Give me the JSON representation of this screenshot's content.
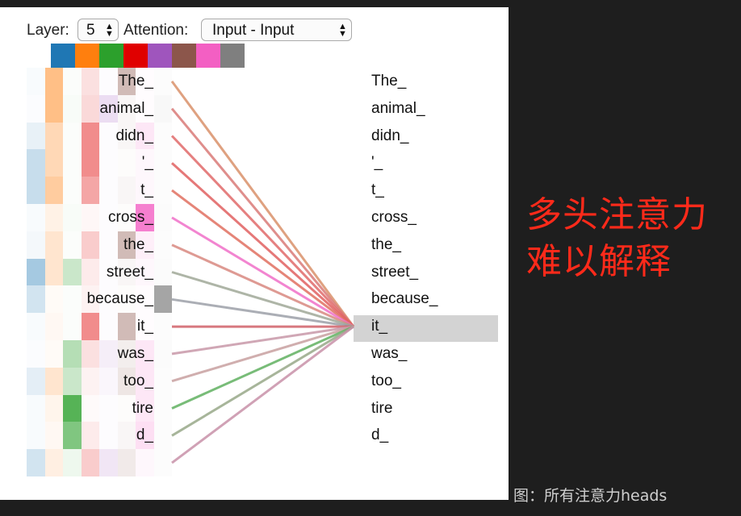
{
  "controls": {
    "layer_label": "Layer:",
    "layer_value": "5",
    "attention_label": "Attention:",
    "attention_value": "Input - Input"
  },
  "head_colors": [
    "#1f77b4",
    "#ff7f0e",
    "#2ca02c",
    "#e00000",
    "#9f55bd",
    "#8c564b",
    "#f35fc3",
    "#7f7f7f"
  ],
  "tokens": [
    "The_",
    "animal_",
    "didn_",
    "'_",
    "t_",
    "cross_",
    "the_",
    "street_",
    "because_",
    "it_",
    "was_",
    "too_",
    "tire",
    "d_",
    ""
  ],
  "selected_token": "it_",
  "attention": [
    [
      0.03,
      0.5,
      0,
      0.12,
      0,
      0.4,
      0.02,
      0
    ],
    [
      0.02,
      0.5,
      0.03,
      0.15,
      0.2,
      0.05,
      0.02,
      0.05
    ],
    [
      0.1,
      0.3,
      0.02,
      0.45,
      0,
      0.05,
      0.15,
      0.02
    ],
    [
      0.25,
      0.3,
      0,
      0.45,
      0,
      0.02,
      0.05,
      0
    ],
    [
      0.25,
      0.4,
      0,
      0.35,
      0,
      0.05,
      0.05,
      0
    ],
    [
      0.03,
      0.1,
      0.03,
      0.03,
      0,
      0,
      0.8,
      0.03
    ],
    [
      0.05,
      0.2,
      0.02,
      0.2,
      0,
      0.4,
      0.1,
      0
    ],
    [
      0.4,
      0.2,
      0.25,
      0.08,
      0,
      0.05,
      0.05,
      0.03
    ],
    [
      0.2,
      0.03,
      0,
      0.05,
      0,
      0,
      0,
      0.7
    ],
    [
      0.03,
      0.05,
      0,
      0.45,
      0,
      0.4,
      0,
      0
    ],
    [
      0.02,
      0.03,
      0.35,
      0.12,
      0.1,
      0.1,
      0.15,
      0.03
    ],
    [
      0.12,
      0.2,
      0.25,
      0.05,
      0.05,
      0.15,
      0.15,
      0
    ],
    [
      0.03,
      0.08,
      0.8,
      0.02,
      0.02,
      0.02,
      0.15,
      0
    ],
    [
      0.03,
      0.05,
      0.6,
      0.08,
      0.02,
      0.05,
      0.2,
      0
    ],
    [
      0.2,
      0.12,
      0.08,
      0.2,
      0.15,
      0.12,
      0.05,
      0
    ]
  ],
  "line_colors": [
    "#d9906a",
    "#d97a78",
    "#e06a6a",
    "#e06060",
    "#e07060",
    "#f070c8",
    "#d88880",
    "#a0a898",
    "#9ca0a8",
    "#d06068",
    "#c898a8",
    "#c8a0a0",
    "#60b060",
    "#98a888",
    "#c890a8"
  ],
  "annotation": {
    "line1": "多头注意力",
    "line2": "难以解释"
  },
  "caption": "图：所有注意力heads"
}
